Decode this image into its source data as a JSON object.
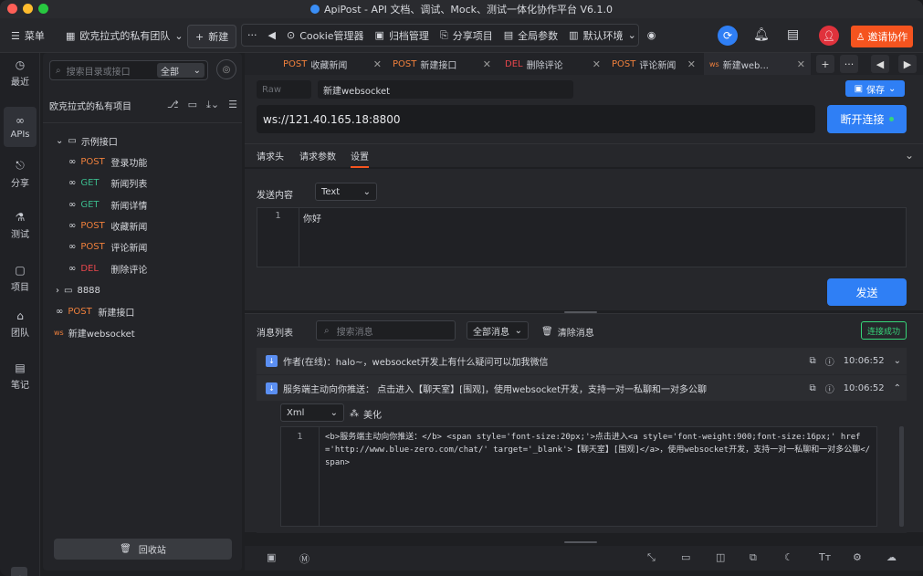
{
  "window": {
    "title": "ApiPost - API 文档、调试、Mock、测试一体化协作平台 V6.1.0"
  },
  "toolbar": {
    "menu": "菜单",
    "team": "欧克拉式的私有团队",
    "new": "新建",
    "more": "···",
    "cookie": "Cookie管理器",
    "archive": "归档管理",
    "share": "分享项目",
    "global_params": "全局参数",
    "env": "默认环境",
    "invite": "邀请协作"
  },
  "rail": [
    {
      "label": "最近",
      "icon": "clock-icon"
    },
    {
      "label": "APIs",
      "icon": "link-icon"
    },
    {
      "label": "分享",
      "icon": "share-icon"
    },
    {
      "label": "测试",
      "icon": "test-icon"
    },
    {
      "label": "项目",
      "icon": "project-icon"
    },
    {
      "label": "团队",
      "icon": "team-icon"
    },
    {
      "label": "笔记",
      "icon": "note-icon"
    }
  ],
  "tree": {
    "search_placeholder": "搜索目录或接口",
    "scope": "全部",
    "project": "欧克拉式的私有项目",
    "folder": "示例接口",
    "items": [
      {
        "method": "POST",
        "name": "登录功能"
      },
      {
        "method": "GET",
        "name": "新闻列表"
      },
      {
        "method": "GET",
        "name": "新闻详情"
      },
      {
        "method": "POST",
        "name": "收藏新闻"
      },
      {
        "method": "POST",
        "name": "评论新闻"
      },
      {
        "method": "DEL",
        "name": "删除评论"
      }
    ],
    "folder2": "8888",
    "extra": {
      "method": "POST",
      "name": "新建接口"
    },
    "ws": {
      "method": "ws",
      "name": "新建websocket"
    },
    "trash": "回收站"
  },
  "tabs": [
    {
      "method": "POST",
      "name": "收藏新闻"
    },
    {
      "method": "POST",
      "name": "新建接口"
    },
    {
      "method": "DEL",
      "name": "删除评论"
    },
    {
      "method": "POST",
      "name": "评论新闻"
    },
    {
      "method": "ws",
      "name": "新建web..."
    }
  ],
  "request": {
    "protocol": "Raw",
    "name": "新建websocket",
    "save": "保存",
    "url": "ws://121.40.165.18:8800",
    "disconnect": "断开连接"
  },
  "subtabs": [
    "请求头",
    "请求参数",
    "设置"
  ],
  "settings": {
    "send_label": "发送内容",
    "format": "Text",
    "line1": "1",
    "content": "你好",
    "send": "发送"
  },
  "messages": {
    "title": "消息列表",
    "search_placeholder": "搜索消息",
    "filter": "全部消息",
    "clear": "清除消息",
    "status": "连接成功",
    "rows": [
      {
        "text": "作者(在线)：halo~，websocket开发上有什么疑问可以加我微信",
        "time": "10:06:52"
      },
      {
        "text": "服务端主动向你推送： 点击进入【聊天室】[围观]，使用websocket开发，支持一对一私聊和一对多公聊",
        "time": "10:06:52"
      }
    ],
    "xml": "Xml",
    "beautify": "美化",
    "code_line": "1",
    "code": "<b>服务端主动向你推送：</b> <span style='font-size:20px;'>点击进入<a style='font-weight:900;font-size:16px;' href='http://www.blue-zero.com/chat/' target='_blank'>【聊天室】[围观]</a>，使用websocket开发，支持一对一私聊和一对多公聊</span>"
  },
  "colors": {
    "accent": "#2f7ff5",
    "invite": "#f5541f",
    "post": "#f0803c",
    "get": "#3bb98c",
    "del": "#e8464c",
    "success": "#37d67a"
  }
}
